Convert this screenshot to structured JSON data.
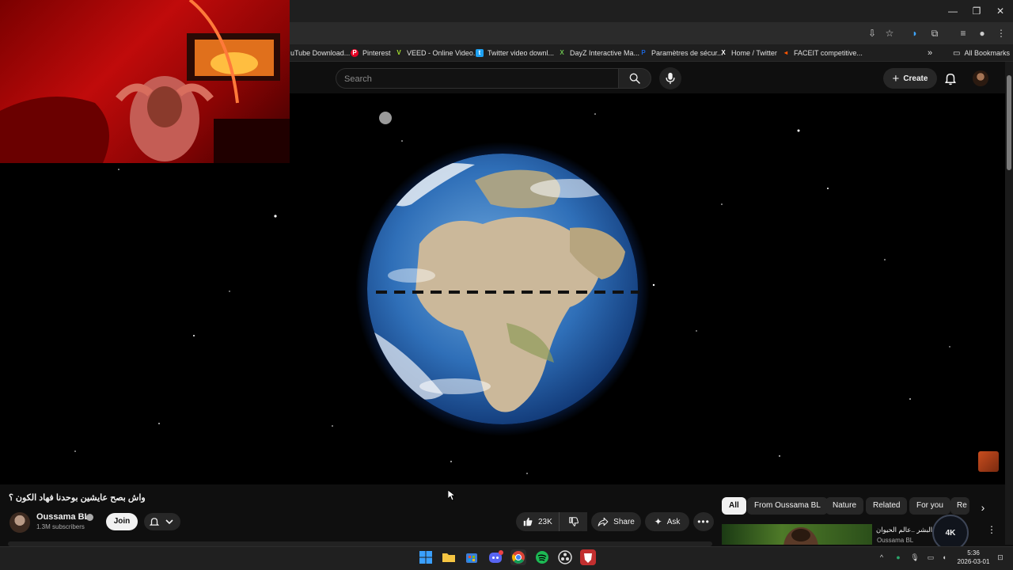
{
  "bookmarks": [
    {
      "label": "uTube Download...",
      "icon": "youtube-downloader-icon",
      "color": "#555555"
    },
    {
      "label": "Pinterest",
      "icon": "pinterest-icon",
      "color": "#e60023"
    },
    {
      "label": "VEED - Online Video...",
      "icon": "veed-icon",
      "color": "#a6e22e"
    },
    {
      "label": "Twitter video downl...",
      "icon": "twitter-downloader-icon",
      "color": "#1da1f2"
    },
    {
      "label": "DayZ Interactive Ma...",
      "icon": "dayz-icon",
      "color": "#6bbf4e"
    },
    {
      "label": "Paramètres de sécur...",
      "icon": "paypal-icon",
      "color": "#1b64d8"
    },
    {
      "label": "Home / Twitter",
      "icon": "x-icon",
      "color": "#000000"
    },
    {
      "label": "FACEIT competitive...",
      "icon": "faceit-icon",
      "color": "#ff5500"
    }
  ],
  "all_bookmarks_label": "All Bookmarks",
  "header": {
    "search_placeholder": "Search",
    "create_label": "Create"
  },
  "video": {
    "title": "واش بصح عايشين بوحدنا فهاد الكون ؟"
  },
  "channel": {
    "name": "Oussama BL",
    "subscribers": "1.3M subscribers",
    "join_label": "Join"
  },
  "actions": {
    "likes": "23K",
    "share_label": "Share",
    "ask_label": "Ask"
  },
  "chips": [
    "All",
    "From Oussama BL",
    "Nature",
    "Related",
    "For you",
    "Re"
  ],
  "recommendation": {
    "title": "! وليس البشر ..عالم الحيوان",
    "channel": "Oussama BL",
    "badge_text": "4K"
  },
  "taskbar": {
    "time": "5:36",
    "date": "2026-03-01"
  },
  "colors": {
    "background": "#0f0f0f",
    "chip_active": "#f1f1f1",
    "earth_ocean": "#2f6fb8",
    "earth_land": "#cbb89a"
  }
}
